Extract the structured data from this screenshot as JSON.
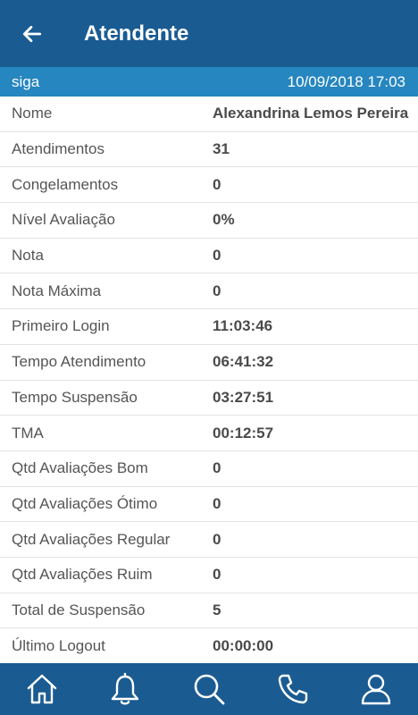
{
  "header": {
    "title": "Atendente",
    "back_icon": "arrow-left-icon"
  },
  "subbar": {
    "left_text": "siga",
    "right_text": "10/09/2018 17:03"
  },
  "rows": [
    {
      "label": "Nome",
      "value": "Alexandrina Lemos Pereira"
    },
    {
      "label": "Atendimentos",
      "value": "31"
    },
    {
      "label": "Congelamentos",
      "value": "0"
    },
    {
      "label": "Nível Avaliação",
      "value": "0%"
    },
    {
      "label": "Nota",
      "value": "0"
    },
    {
      "label": "Nota Máxima",
      "value": "0"
    },
    {
      "label": "Primeiro Login",
      "value": "11:03:46"
    },
    {
      "label": "Tempo Atendimento",
      "value": "06:41:32"
    },
    {
      "label": "Tempo Suspensão",
      "value": "03:27:51"
    },
    {
      "label": "TMA",
      "value": "00:12:57"
    },
    {
      "label": "Qtd Avaliações Bom",
      "value": "0"
    },
    {
      "label": "Qtd Avaliações Ótimo",
      "value": "0"
    },
    {
      "label": "Qtd Avaliações Regular",
      "value": "0"
    },
    {
      "label": "Qtd Avaliações Ruim",
      "value": "0"
    },
    {
      "label": "Total de Suspensão",
      "value": "5"
    },
    {
      "label": "Último Logout",
      "value": "00:00:00"
    }
  ],
  "bottom_nav": [
    "home-icon",
    "bell-icon",
    "search-icon",
    "phone-icon",
    "user-icon"
  ],
  "colors": {
    "header_bg": "#1a5b92",
    "subbar_bg": "#2686bf",
    "text": "#555555"
  }
}
